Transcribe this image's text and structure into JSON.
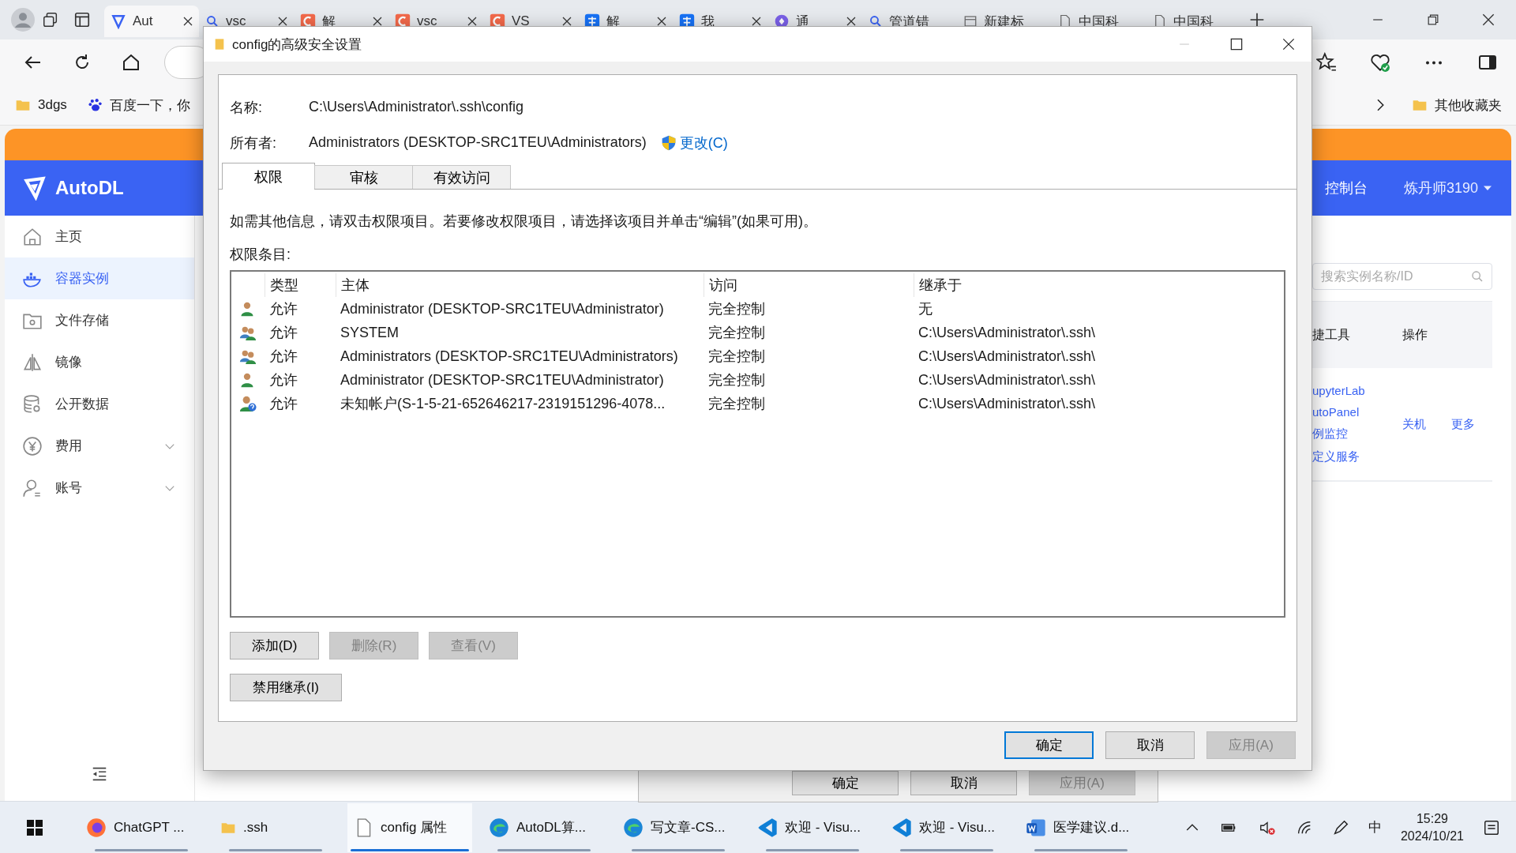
{
  "browser": {
    "tabs": [
      {
        "label": "Aut",
        "kind": "autodl",
        "selected": true,
        "closable": true
      },
      {
        "label": "vsc",
        "kind": "search",
        "selected": false,
        "closable": true
      },
      {
        "label": "解",
        "kind": "csdn",
        "selected": false,
        "closable": true
      },
      {
        "label": "vsc",
        "kind": "csdn",
        "selected": false,
        "closable": true
      },
      {
        "label": "VS",
        "kind": "csdn",
        "selected": false,
        "closable": true
      },
      {
        "label": "解",
        "kind": "zhihu",
        "selected": false,
        "closable": true
      },
      {
        "label": "我",
        "kind": "zhihu",
        "selected": false,
        "closable": true
      },
      {
        "label": "通",
        "kind": "app",
        "selected": false,
        "closable": true
      },
      {
        "label": "管道错",
        "kind": "search",
        "selected": false,
        "closable": false
      },
      {
        "label": "新建标",
        "kind": "newtab",
        "selected": false,
        "closable": false
      },
      {
        "label": "中国科",
        "kind": "doc",
        "selected": false,
        "closable": false
      },
      {
        "label": "中国科",
        "kind": "doc",
        "selected": false,
        "closable": false
      }
    ],
    "bookmarks": [
      {
        "label": "3dgs",
        "kind": "folder"
      },
      {
        "label": "百度一下，你",
        "kind": "baidu"
      }
    ],
    "other_bookmarks": "其他收藏夹"
  },
  "page": {
    "brand": "AutoDL",
    "nav": [
      {
        "label": "主页",
        "selected": false,
        "submenu": false
      },
      {
        "label": "容器实例",
        "selected": true,
        "submenu": false
      },
      {
        "label": "文件存储",
        "selected": false,
        "submenu": false
      },
      {
        "label": "镜像",
        "selected": false,
        "submenu": false
      },
      {
        "label": "公开数据",
        "selected": false,
        "submenu": false
      },
      {
        "label": "费用",
        "selected": false,
        "submenu": true
      },
      {
        "label": "账号",
        "selected": false,
        "submenu": true
      }
    ],
    "header_link": "控制台",
    "user_menu": "炼丹师3190",
    "search": {
      "placeholder": "搜索实例名称/ID"
    },
    "columns": [
      "捷工具",
      "操作"
    ],
    "tool_links": [
      "upyterLab",
      "utoPanel",
      "例监控",
      "定义服务"
    ],
    "actions": [
      "关机",
      "更多"
    ]
  },
  "dialog": {
    "title": "config的高级安全设置",
    "name_label": "名称:",
    "name": "C:\\Users\\Administrator\\.ssh\\config",
    "owner_label": "所有者:",
    "owner": "Administrators (DESKTOP-SRC1TEU\\Administrators)",
    "change_link": "更改(C)",
    "tabs": [
      {
        "label": "权限",
        "selected": true
      },
      {
        "label": "审核",
        "selected": false
      },
      {
        "label": "有效访问",
        "selected": false
      }
    ],
    "hint": "如需其他信息，请双击权限项目。若要修改权限项目，请选择该项目并单击“编辑”(如果可用)。",
    "entries_label": "权限条目:",
    "columns": [
      "类型",
      "主体",
      "访问",
      "继承于"
    ],
    "rows": [
      {
        "kind": "user",
        "type": "允许",
        "principal": "Administrator (DESKTOP-SRC1TEU\\Administrator)",
        "access": "完全控制",
        "inherited_from": "无"
      },
      {
        "kind": "group",
        "type": "允许",
        "principal": "SYSTEM",
        "access": "完全控制",
        "inherited_from": "C:\\Users\\Administrator\\.ssh\\"
      },
      {
        "kind": "group",
        "type": "允许",
        "principal": "Administrators (DESKTOP-SRC1TEU\\Administrators)",
        "access": "完全控制",
        "inherited_from": "C:\\Users\\Administrator\\.ssh\\"
      },
      {
        "kind": "user",
        "type": "允许",
        "principal": "Administrator (DESKTOP-SRC1TEU\\Administrator)",
        "access": "完全控制",
        "inherited_from": "C:\\Users\\Administrator\\.ssh\\"
      },
      {
        "kind": "unknown",
        "type": "允许",
        "principal": "未知帐户(S-1-5-21-652646217-2319151296-4078...",
        "access": "完全控制",
        "inherited_from": "C:\\Users\\Administrator\\.ssh\\"
      }
    ],
    "list_buttons": [
      {
        "label": "添加(D)",
        "disabled": false
      },
      {
        "label": "删除(R)",
        "disabled": true
      },
      {
        "label": "查看(V)",
        "disabled": true
      }
    ],
    "inheritance_button": "禁用继承(I)",
    "footer_buttons": [
      {
        "label": "确定",
        "disabled": false,
        "default": true
      },
      {
        "label": "取消",
        "disabled": false,
        "default": false
      },
      {
        "label": "应用(A)",
        "disabled": true,
        "default": false
      }
    ]
  },
  "parent_dialog": {
    "buttons": [
      {
        "label": "确定",
        "disabled": false
      },
      {
        "label": "取消",
        "disabled": false
      },
      {
        "label": "应用(A)",
        "disabled": true
      }
    ]
  },
  "taskbar": {
    "apps": [
      {
        "label": "ChatGPT ...",
        "kind": "firefox",
        "selected": false
      },
      {
        "label": ".ssh",
        "kind": "folder",
        "selected": false
      },
      {
        "label": "config 属性",
        "kind": "file",
        "selected": true
      },
      {
        "label": "AutoDL算...",
        "kind": "edge",
        "selected": false
      },
      {
        "label": "写文章-CS...",
        "kind": "edge",
        "selected": false
      },
      {
        "label": "欢迎 - Visu...",
        "kind": "vscode",
        "selected": false
      },
      {
        "label": "欢迎 - Visu...",
        "kind": "vscode",
        "selected": false
      },
      {
        "label": "医学建议.d...",
        "kind": "word",
        "selected": false
      }
    ],
    "ime": "中",
    "time": "15:29",
    "date": "2024/10/21"
  }
}
